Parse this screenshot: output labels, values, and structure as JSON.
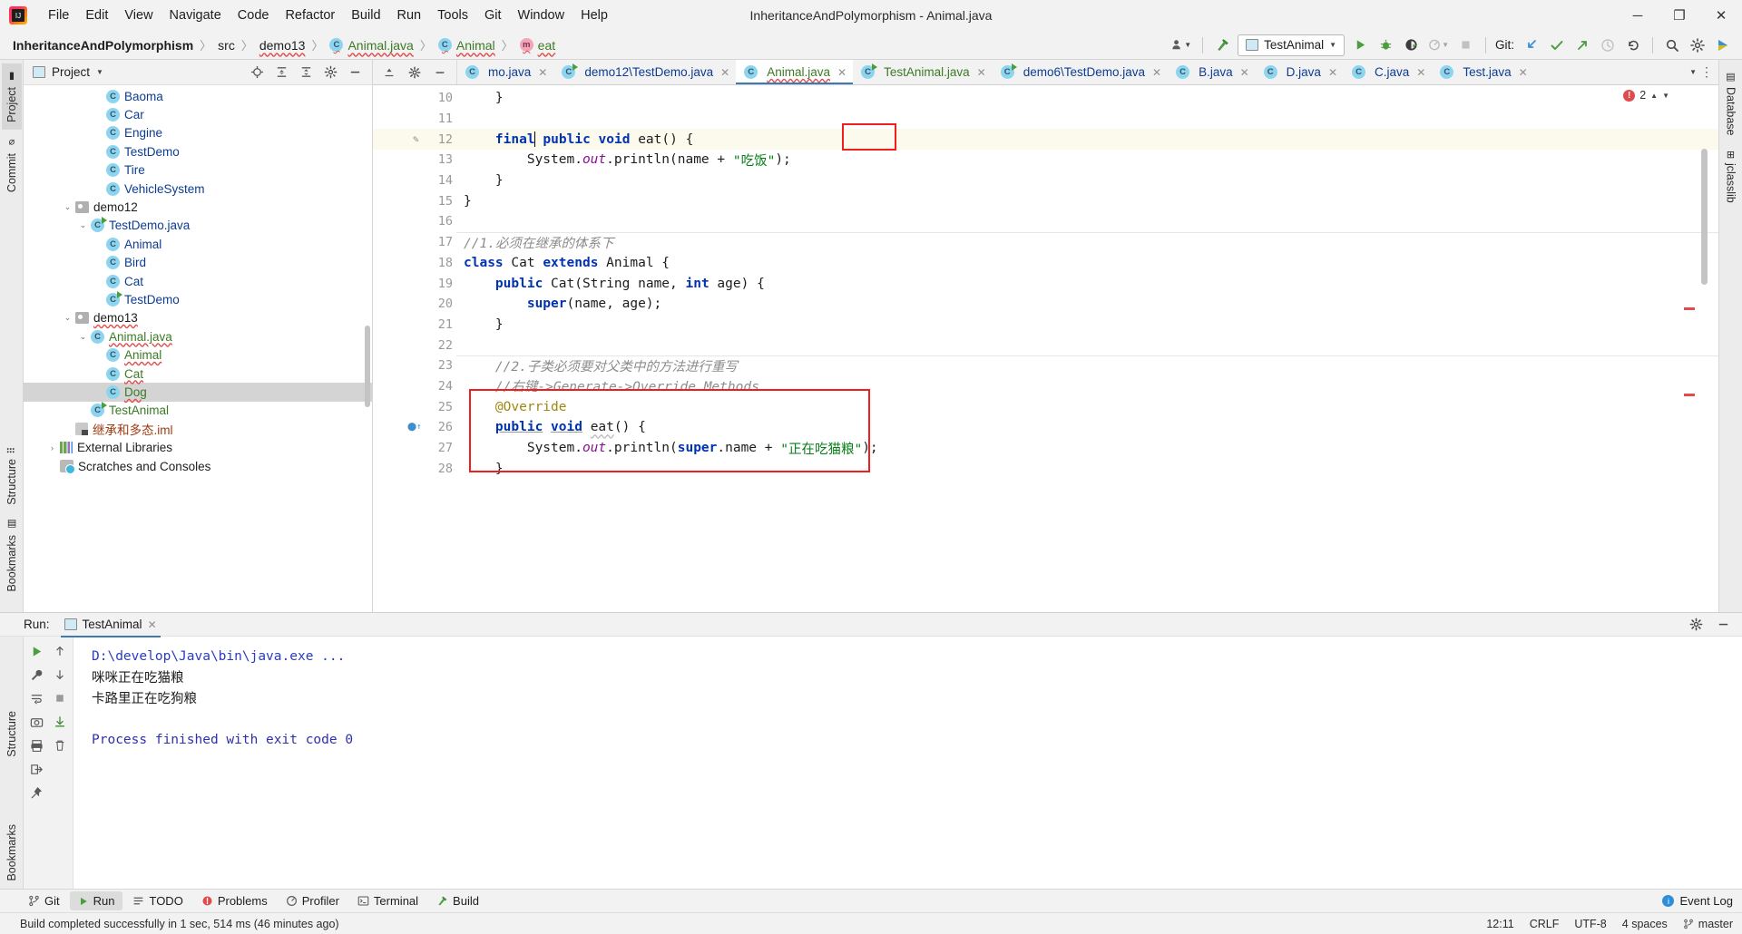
{
  "window": {
    "title": "InheritanceAndPolymorphism - Animal.java",
    "minimize": "─",
    "maximize": "❐",
    "close": "✕"
  },
  "menu": {
    "items": [
      {
        "label": "File"
      },
      {
        "label": "Edit"
      },
      {
        "label": "View"
      },
      {
        "label": "Navigate"
      },
      {
        "label": "Code"
      },
      {
        "label": "Refactor"
      },
      {
        "label": "Build"
      },
      {
        "label": "Run"
      },
      {
        "label": "Tools"
      },
      {
        "label": "Git"
      },
      {
        "label": "Window"
      },
      {
        "label": "Help"
      }
    ]
  },
  "breadcrumb": {
    "project": "InheritanceAndPolymorphism",
    "src": "src",
    "package": "demo13",
    "file": "Animal.java",
    "class": "Animal",
    "method": "eat",
    "class_icon": "C",
    "method_icon": "m",
    "separator": "〉"
  },
  "toolbar": {
    "run_config": "TestAnimal",
    "git_label": "Git:",
    "icons": [
      "user-avatar-icon",
      "build-hammer-icon",
      "run-icon",
      "debug-icon",
      "run-with-coverage-icon",
      "profiler-icon",
      "stop-icon",
      "git-update-icon",
      "git-commit-icon",
      "git-push-icon",
      "git-history-icon",
      "git-rollback-icon",
      "search-everywhere-icon",
      "settings-gear-icon",
      "idea-feedback-icon"
    ]
  },
  "left_rail": {
    "tabs": [
      {
        "label": "Project",
        "icon": "project-icon",
        "active": true
      },
      {
        "label": "Commit",
        "icon": "commit-icon",
        "active": false
      }
    ],
    "bottom": [
      {
        "label": "Structure",
        "icon": "structure-icon"
      },
      {
        "label": "Bookmarks",
        "icon": "bookmarks-icon"
      }
    ]
  },
  "right_rail": {
    "tabs": [
      {
        "label": "Database",
        "icon": "database-icon"
      },
      {
        "label": "jclasslib",
        "icon": "jclasslib-icon"
      }
    ]
  },
  "project_panel": {
    "title": "Project",
    "header_icons": [
      "locate-icon",
      "collapse-all-icon",
      "expand-all-icon",
      "settings-icon",
      "hide-icon"
    ],
    "tree": [
      {
        "indent": 4,
        "twisty": "",
        "icon": "class",
        "label": "Baoma",
        "color": "blue"
      },
      {
        "indent": 4,
        "twisty": "",
        "icon": "class",
        "label": "Car",
        "color": "blue"
      },
      {
        "indent": 4,
        "twisty": "",
        "icon": "class",
        "label": "Engine",
        "color": "blue"
      },
      {
        "indent": 4,
        "twisty": "",
        "icon": "class",
        "label": "TestDemo",
        "color": "blue"
      },
      {
        "indent": 4,
        "twisty": "",
        "icon": "class",
        "label": "Tire",
        "color": "blue"
      },
      {
        "indent": 4,
        "twisty": "",
        "icon": "class",
        "label": "VehicleSystem",
        "color": "blue"
      },
      {
        "indent": 2,
        "twisty": "open",
        "icon": "folder",
        "label": "demo12",
        "color": "dark"
      },
      {
        "indent": 3,
        "twisty": "open",
        "icon": "class-run",
        "label": "TestDemo.java",
        "color": "blue"
      },
      {
        "indent": 4,
        "twisty": "",
        "icon": "class",
        "label": "Animal",
        "color": "blue"
      },
      {
        "indent": 4,
        "twisty": "",
        "icon": "class",
        "label": "Bird",
        "color": "blue"
      },
      {
        "indent": 4,
        "twisty": "",
        "icon": "class",
        "label": "Cat",
        "color": "blue"
      },
      {
        "indent": 4,
        "twisty": "",
        "icon": "class-run",
        "label": "TestDemo",
        "color": "blue"
      },
      {
        "indent": 2,
        "twisty": "open",
        "icon": "folder",
        "label": "demo13",
        "color": "dark",
        "squiggle": true
      },
      {
        "indent": 3,
        "twisty": "open",
        "icon": "class",
        "label": "Animal.java",
        "color": "green",
        "squiggle": true
      },
      {
        "indent": 4,
        "twisty": "",
        "icon": "class",
        "label": "Animal",
        "color": "green",
        "squiggle": true
      },
      {
        "indent": 4,
        "twisty": "",
        "icon": "class",
        "label": "Cat",
        "color": "green",
        "squiggle": true
      },
      {
        "indent": 4,
        "twisty": "",
        "icon": "class",
        "label": "Dog",
        "color": "green",
        "squiggle": true,
        "selected": true
      },
      {
        "indent": 3,
        "twisty": "",
        "icon": "class-run",
        "label": "TestAnimal",
        "color": "green"
      },
      {
        "indent": 2,
        "twisty": "",
        "icon": "iml",
        "label": "继承和多态.iml",
        "color": "orange"
      },
      {
        "indent": 1,
        "twisty": "closed",
        "icon": "lib",
        "label": "External Libraries",
        "color": "dark"
      },
      {
        "indent": 1,
        "twisty": "",
        "icon": "scratch",
        "label": "Scratches and Consoles",
        "color": "dark"
      }
    ]
  },
  "editor": {
    "tabs": [
      {
        "label": "mo.java",
        "icon": "class",
        "active": false,
        "truncated": true
      },
      {
        "label": "demo12\\TestDemo.java",
        "icon": "class-run",
        "active": false
      },
      {
        "label": "Animal.java",
        "icon": "class",
        "active": true,
        "color": "green",
        "squiggle": true
      },
      {
        "label": "TestAnimal.java",
        "icon": "class-run",
        "active": false,
        "color": "green"
      },
      {
        "label": "demo6\\TestDemo.java",
        "icon": "class-run",
        "active": false
      },
      {
        "label": "B.java",
        "icon": "class",
        "active": false
      },
      {
        "label": "D.java",
        "icon": "class",
        "active": false
      },
      {
        "label": "C.java",
        "icon": "class",
        "active": false
      },
      {
        "label": "Test.java",
        "icon": "class",
        "active": false
      }
    ],
    "error_count": "2",
    "lines": [
      {
        "num": "10",
        "tokens": [
          {
            "t": "    }",
            "c": "op"
          }
        ]
      },
      {
        "num": "11",
        "tokens": []
      },
      {
        "num": "12",
        "highlight": true,
        "gutter_mark": "R",
        "fold": "minus",
        "tokens": [
          {
            "t": "    ",
            "c": "op"
          },
          {
            "t": "final",
            "c": "kw"
          },
          {
            "t": "",
            "c": "caret"
          },
          {
            "t": " public",
            "c": "kw"
          },
          {
            "t": " ",
            "c": "op"
          },
          {
            "t": "void",
            "c": "kw"
          },
          {
            "t": " ",
            "c": "op"
          },
          {
            "t": "eat",
            "c": "cls"
          },
          {
            "t": "() {",
            "c": "op"
          }
        ]
      },
      {
        "num": "13",
        "tokens": [
          {
            "t": "        System.",
            "c": "op"
          },
          {
            "t": "out",
            "c": "fld"
          },
          {
            "t": ".println(",
            "c": "op"
          },
          {
            "t": "name",
            "c": "op"
          },
          {
            "t": " + ",
            "c": "op"
          },
          {
            "t": "\"吃饭\"",
            "c": "str"
          },
          {
            "t": ");",
            "c": "op"
          }
        ]
      },
      {
        "num": "14",
        "fold": "minus",
        "tokens": [
          {
            "t": "    }",
            "c": "op"
          }
        ]
      },
      {
        "num": "15",
        "fold": "minus",
        "tokens": [
          {
            "t": "}",
            "c": "op"
          }
        ]
      },
      {
        "num": "16",
        "tokens": []
      },
      {
        "num": "17",
        "separator": true,
        "tokens": [
          {
            "t": "//1.必须在继承的体系下",
            "c": "cmt"
          }
        ]
      },
      {
        "num": "18",
        "fold": "minus",
        "tokens": [
          {
            "t": "class",
            "c": "kw"
          },
          {
            "t": " ",
            "c": "op"
          },
          {
            "t": "Cat",
            "c": "cls"
          },
          {
            "t": " ",
            "c": "op"
          },
          {
            "t": "extends",
            "c": "kw"
          },
          {
            "t": " ",
            "c": "op"
          },
          {
            "t": "Animal",
            "c": "cls"
          },
          {
            "t": " {",
            "c": "op"
          }
        ]
      },
      {
        "num": "19",
        "fold": "minus",
        "tokens": [
          {
            "t": "    ",
            "c": "op"
          },
          {
            "t": "public",
            "c": "kw"
          },
          {
            "t": " ",
            "c": "op"
          },
          {
            "t": "Cat",
            "c": "cls"
          },
          {
            "t": "(",
            "c": "op"
          },
          {
            "t": "String",
            "c": "cls"
          },
          {
            "t": " name, ",
            "c": "op"
          },
          {
            "t": "int",
            "c": "kw"
          },
          {
            "t": " age) {",
            "c": "op"
          }
        ]
      },
      {
        "num": "20",
        "tokens": [
          {
            "t": "        ",
            "c": "op"
          },
          {
            "t": "super",
            "c": "kw"
          },
          {
            "t": "(name, age);",
            "c": "op"
          }
        ]
      },
      {
        "num": "21",
        "fold": "minus",
        "tokens": [
          {
            "t": "    }",
            "c": "op"
          }
        ]
      },
      {
        "num": "22",
        "tokens": []
      },
      {
        "num": "23",
        "separator": true,
        "fold": "minus",
        "tokens": [
          {
            "t": "    //2.子类必须要对父类中的方法进行重写",
            "c": "cmt"
          }
        ]
      },
      {
        "num": "24",
        "fold": "minus",
        "tokens": [
          {
            "t": "    //右键->Generate->Override Methods",
            "c": "cmt"
          }
        ]
      },
      {
        "num": "25",
        "tokens": [
          {
            "t": "    ",
            "c": "op"
          },
          {
            "t": "@Override",
            "c": "anno"
          }
        ]
      },
      {
        "num": "26",
        "gutter_run": true,
        "tokens": [
          {
            "t": "    ",
            "c": "op"
          },
          {
            "t": "public",
            "c": "kw under"
          },
          {
            "t": " ",
            "c": "op"
          },
          {
            "t": "void",
            "c": "kw under"
          },
          {
            "t": " ",
            "c": "op"
          },
          {
            "t": "eat",
            "c": "cls under-sq"
          },
          {
            "t": "() {",
            "c": "op"
          }
        ]
      },
      {
        "num": "27",
        "tokens": [
          {
            "t": "        System.",
            "c": "op"
          },
          {
            "t": "out",
            "c": "fld"
          },
          {
            "t": ".println(",
            "c": "op"
          },
          {
            "t": "super",
            "c": "kw"
          },
          {
            "t": ".name + ",
            "c": "op"
          },
          {
            "t": "\"正在吃猫粮\"",
            "c": "str"
          },
          {
            "t": ");",
            "c": "op"
          }
        ]
      },
      {
        "num": "28",
        "tokens": [
          {
            "t": "    }",
            "c": "op"
          }
        ]
      }
    ]
  },
  "run_panel": {
    "label": "Run:",
    "tab": "TestAnimal",
    "close": "✕",
    "console": [
      {
        "text": "D:\\develop\\Java\\bin\\java.exe ...",
        "cls": "c-cmd"
      },
      {
        "text": "咪咪正在吃猫粮",
        "cls": "c-out"
      },
      {
        "text": "卡路里正在吃狗粮",
        "cls": "c-out"
      },
      {
        "text": "",
        "cls": "c-out"
      },
      {
        "text": "Process finished with exit code 0",
        "cls": "c-fin"
      }
    ],
    "side_icons": [
      "rerun-icon",
      "up-arrow-icon",
      "down-arrow-icon",
      "stop-icon",
      "soft-wrap-icon",
      "scroll-to-end-icon",
      "print-icon",
      "wrench-icon",
      "camera-icon",
      "clear-all-icon",
      "export-icon"
    ],
    "head_icons": [
      "settings-gear-icon",
      "hide-icon"
    ]
  },
  "bottom_tabs": {
    "items": [
      {
        "label": "Git",
        "icon": "git-branch-icon",
        "active": false
      },
      {
        "label": "Run",
        "icon": "run-icon",
        "active": true
      },
      {
        "label": "TODO",
        "icon": "todo-icon",
        "active": false
      },
      {
        "label": "Problems",
        "icon": "problems-icon",
        "active": false
      },
      {
        "label": "Profiler",
        "icon": "profiler-icon",
        "active": false
      },
      {
        "label": "Terminal",
        "icon": "terminal-icon",
        "active": false
      },
      {
        "label": "Build",
        "icon": "build-icon",
        "active": false
      }
    ],
    "event_log": "Event Log"
  },
  "status_bar": {
    "message": "Build completed successfully in 1 sec, 514 ms (46 minutes ago)",
    "position": "12:11",
    "line_sep": "CRLF",
    "encoding": "UTF-8",
    "indent": "4 spaces",
    "branch": "master",
    "branch_icon": "git-branch-icon"
  },
  "colors": {
    "accent_blue": "#3d7ab5",
    "error_red": "#e04b4b",
    "annotation_red": "#f01e1e",
    "git_green": "#3b7a25",
    "keyword_blue": "#0033b3",
    "string_green": "#067d17"
  }
}
